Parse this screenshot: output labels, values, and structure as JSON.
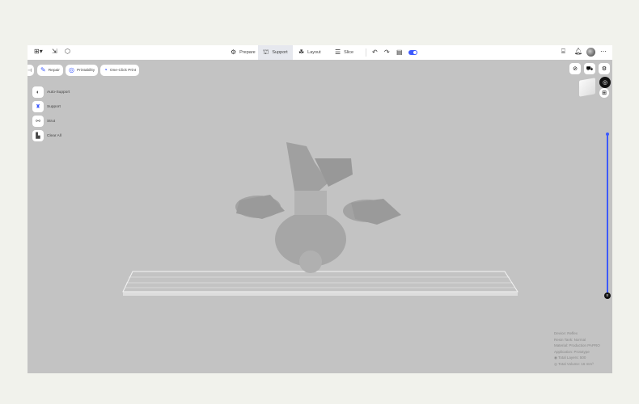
{
  "topbar": {
    "left_icons": [
      "grid-menu-icon",
      "import-icon",
      "cube-icon"
    ],
    "tabs": [
      {
        "label": "Prepare",
        "icon": "gear-icon"
      },
      {
        "label": "Support",
        "icon": "support-icon",
        "active": true
      },
      {
        "label": "Layout",
        "icon": "layout-icon"
      },
      {
        "label": "Slice",
        "icon": "slice-icon"
      }
    ],
    "actions": [
      "undo-icon",
      "redo-icon",
      "save-icon",
      "toggle-icon"
    ],
    "right_icons": [
      "feedback-icon",
      "bell-icon",
      "avatar",
      "more-icon"
    ]
  },
  "quick_actions": [
    {
      "label": "Repair"
    },
    {
      "label": "Printability"
    },
    {
      "label": "One-Click Print"
    }
  ],
  "tools": [
    {
      "label": "Auto-Support"
    },
    {
      "label": "Support"
    },
    {
      "label": "Strut"
    },
    {
      "label": "Clear All"
    }
  ],
  "info": {
    "device": "Device: Reflex",
    "tank": "Resin Tank: Normal",
    "material": "Material: Production PAPRO",
    "application": "Application: Prototype",
    "layers": "Total Layers: 500",
    "volume": "Total Volume: 16 mm³"
  },
  "accent": "#3d5afe",
  "layer_slider": {
    "value_fraction": 1.0
  }
}
